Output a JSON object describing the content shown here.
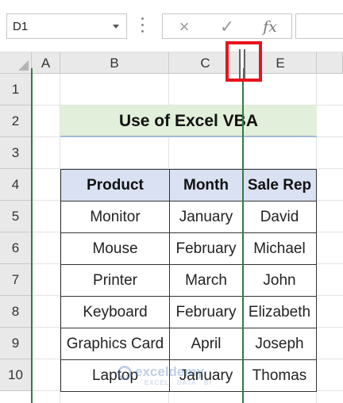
{
  "formula_bar": {
    "name_box_value": "D1",
    "cancel_icon": "×",
    "enter_icon": "✓",
    "function_label": "fx",
    "formula_value": ""
  },
  "columns": [
    "A",
    "B",
    "C",
    "E"
  ],
  "rows": [
    "1",
    "2",
    "3",
    "4",
    "5",
    "6",
    "7",
    "8",
    "9",
    "10"
  ],
  "sheet": {
    "title": "Use of Excel VBA",
    "table_headers": [
      "Product",
      "Month",
      "Sale Rep"
    ],
    "table_rows": [
      [
        "Monitor",
        "January",
        "David"
      ],
      [
        "Mouse",
        "February",
        "Michael"
      ],
      [
        "Printer",
        "March",
        "John"
      ],
      [
        "Keyboard",
        "February",
        "Elizabeth"
      ],
      [
        "Graphics Card",
        "April",
        "Joseph"
      ],
      [
        "Laptop",
        "January",
        "Thomas"
      ]
    ]
  },
  "watermark": {
    "main": "exceldemy",
    "sub": "EXCEL · DATA · BI"
  },
  "colors": {
    "title_fill": "#e2efda",
    "header_fill": "#d9e1f2",
    "highlight": "#e8141b",
    "drag_line": "#2f7d45"
  }
}
